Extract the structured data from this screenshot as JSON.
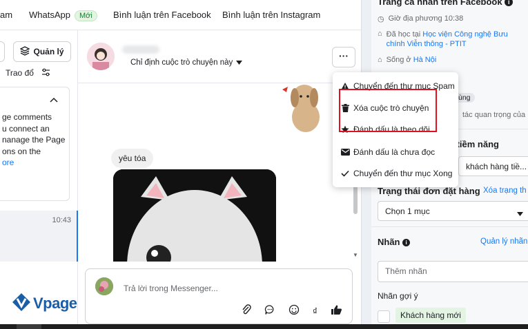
{
  "tabs": {
    "items": [
      {
        "label": "am"
      },
      {
        "label": "WhatsApp",
        "badge": "Mới"
      },
      {
        "label": "Bình luận trên Facebook"
      },
      {
        "label": "Bình luận trên Instagram"
      }
    ]
  },
  "left": {
    "manage_label": "Quản lý",
    "exchange_label": "Trao đổ",
    "info_text": "ge comments\nu connect an\nnanage the Page\nons on the",
    "info_more": "ore",
    "conversation_time": "10:43"
  },
  "logo": {
    "text": "Vpage"
  },
  "chat": {
    "assign_label": "Chỉ định cuộc trò chuyện này",
    "more_label": "···",
    "message": "yêu tóa",
    "reply_placeholder": "Trả lời trong Messenger...",
    "currency_symbol": "₫"
  },
  "menu": {
    "items": [
      {
        "label": "Chuyển đến thư mục Spam",
        "icon": "warning-icon"
      },
      {
        "label": "Xóa cuộc trò chuyện",
        "icon": "trash-icon"
      },
      {
        "label": "Đánh dấu là theo dõi",
        "icon": "star-icon"
      },
      {
        "label": "Đánh dấu là chưa đọc",
        "icon": "mail-icon"
      },
      {
        "label": "Chuyển đến thư mục Xong",
        "icon": "check-icon"
      }
    ]
  },
  "right": {
    "title": "Trang cá nhân trên Facebook",
    "local_time": "Giờ địa phương 10:38",
    "studied_prefix": "Đã học tại",
    "studied_link": "Học viện Công nghệ Bưu chính Viễn thông - PTIT",
    "lives_prefix": "Sống ở",
    "lives_link": "Hà Nội",
    "chip": "ùng",
    "small_text": "tác quan trọng của",
    "potential_label": "g tiềm năng",
    "potential_value": "khách hàng tiề...",
    "order_status_label": "Trạng thái đơn đặt hàng",
    "order_status_clear": "Xóa trạng th",
    "order_select": "Chọn 1 mục",
    "labels_title": "Nhãn",
    "labels_manage": "Quản lý nhãn",
    "add_label_placeholder": "Thêm nhãn",
    "suggested_title": "Nhãn gợi ý",
    "suggested_chip": "Khách hàng mới"
  },
  "colors": {
    "accent": "#1877f2",
    "highlight": "#e0101f",
    "badge_green": "#1e7b34"
  }
}
